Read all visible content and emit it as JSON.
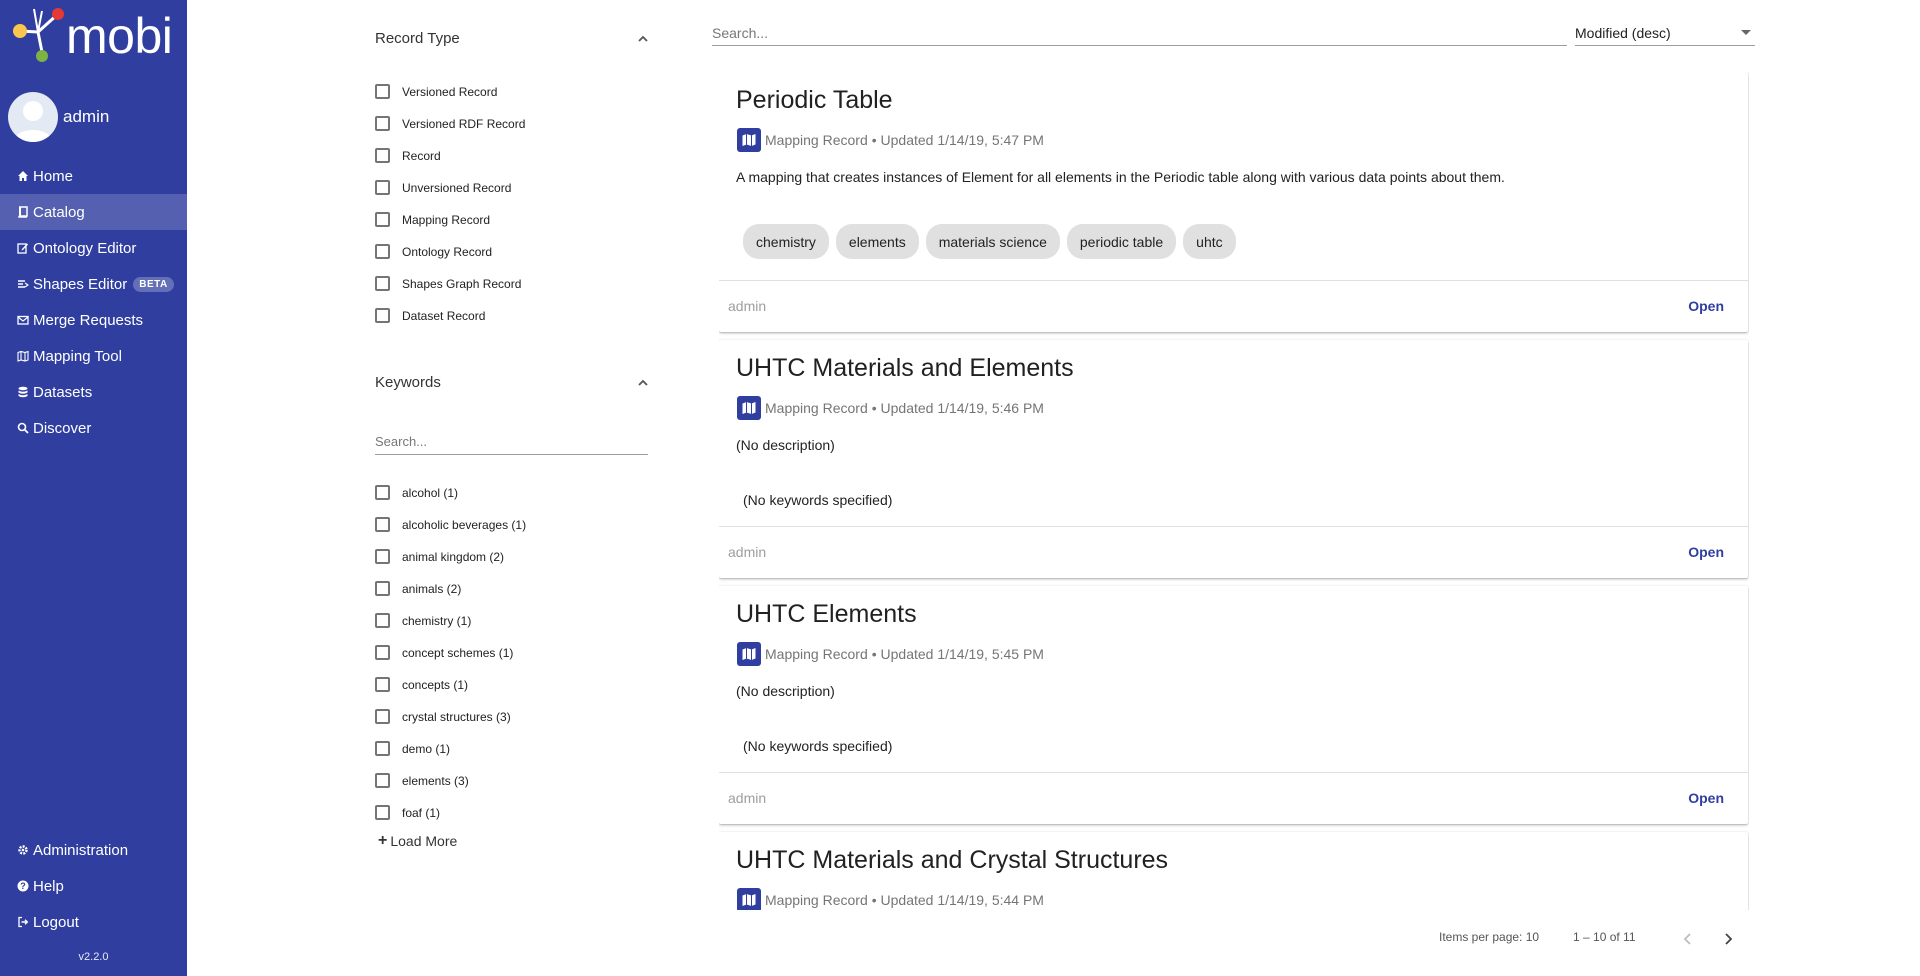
{
  "brand": {
    "name": "mobi"
  },
  "user": {
    "name": "admin"
  },
  "nav": {
    "items": [
      {
        "label": "Home",
        "icon": "home-icon"
      },
      {
        "label": "Catalog",
        "icon": "book-icon",
        "active": true
      },
      {
        "label": "Ontology Editor",
        "icon": "edit-icon"
      },
      {
        "label": "Shapes Editor",
        "icon": "shapes-icon",
        "badge": "BETA"
      },
      {
        "label": "Merge Requests",
        "icon": "envelope-icon"
      },
      {
        "label": "Mapping Tool",
        "icon": "map-icon"
      },
      {
        "label": "Datasets",
        "icon": "database-icon"
      },
      {
        "label": "Discover",
        "icon": "search-icon"
      }
    ],
    "bottom": [
      {
        "label": "Administration",
        "icon": "gear-icon"
      },
      {
        "label": "Help",
        "icon": "question-icon"
      },
      {
        "label": "Logout",
        "icon": "logout-icon"
      }
    ],
    "version": "v2.2.0"
  },
  "filters": {
    "record_type": {
      "title": "Record Type",
      "options": [
        "Versioned Record",
        "Versioned RDF Record",
        "Record",
        "Unversioned Record",
        "Mapping Record",
        "Ontology Record",
        "Shapes Graph Record",
        "Dataset Record"
      ]
    },
    "keywords": {
      "title": "Keywords",
      "search_placeholder": "Search...",
      "options": [
        "alcohol (1)",
        "alcoholic beverages (1)",
        "animal kingdom (2)",
        "animals (2)",
        "chemistry (1)",
        "concept schemes (1)",
        "concepts (1)",
        "crystal structures (3)",
        "demo (1)",
        "elements (3)",
        "foaf (1)"
      ],
      "load_more": "Load More"
    }
  },
  "search": {
    "placeholder": "Search..."
  },
  "sort": {
    "selected": "Modified (desc)"
  },
  "records": [
    {
      "title": "Periodic Table",
      "type": "Mapping Record",
      "updated": "• Updated 1/14/19, 5:47 PM",
      "description": "A mapping that creates instances of Element for all elements in the Periodic table along with various data points about them.",
      "keywords": [
        "chemistry",
        "elements",
        "materials science",
        "periodic table",
        "uhtc"
      ],
      "owner": "admin",
      "action": "Open"
    },
    {
      "title": "UHTC Materials and Elements",
      "type": "Mapping Record",
      "updated": "• Updated 1/14/19, 5:46 PM",
      "description": "(No description)",
      "keywords": [],
      "no_keywords": "(No keywords specified)",
      "owner": "admin",
      "action": "Open"
    },
    {
      "title": "UHTC Elements",
      "type": "Mapping Record",
      "updated": "• Updated 1/14/19, 5:45 PM",
      "description": "(No description)",
      "keywords": [],
      "no_keywords": "(No keywords specified)",
      "owner": "admin",
      "action": "Open"
    },
    {
      "title": "UHTC Materials and Crystal Structures",
      "type": "Mapping Record",
      "updated": "• Updated 1/14/19, 5:44 PM"
    }
  ],
  "pagination": {
    "items_per_page_label": "Items per page:",
    "items_per_page": "10",
    "range": "1 – 10 of 11"
  },
  "colors": {
    "sidebar": "#303f9f",
    "accent": "#303f9f",
    "chip": "#e0e0e0"
  }
}
